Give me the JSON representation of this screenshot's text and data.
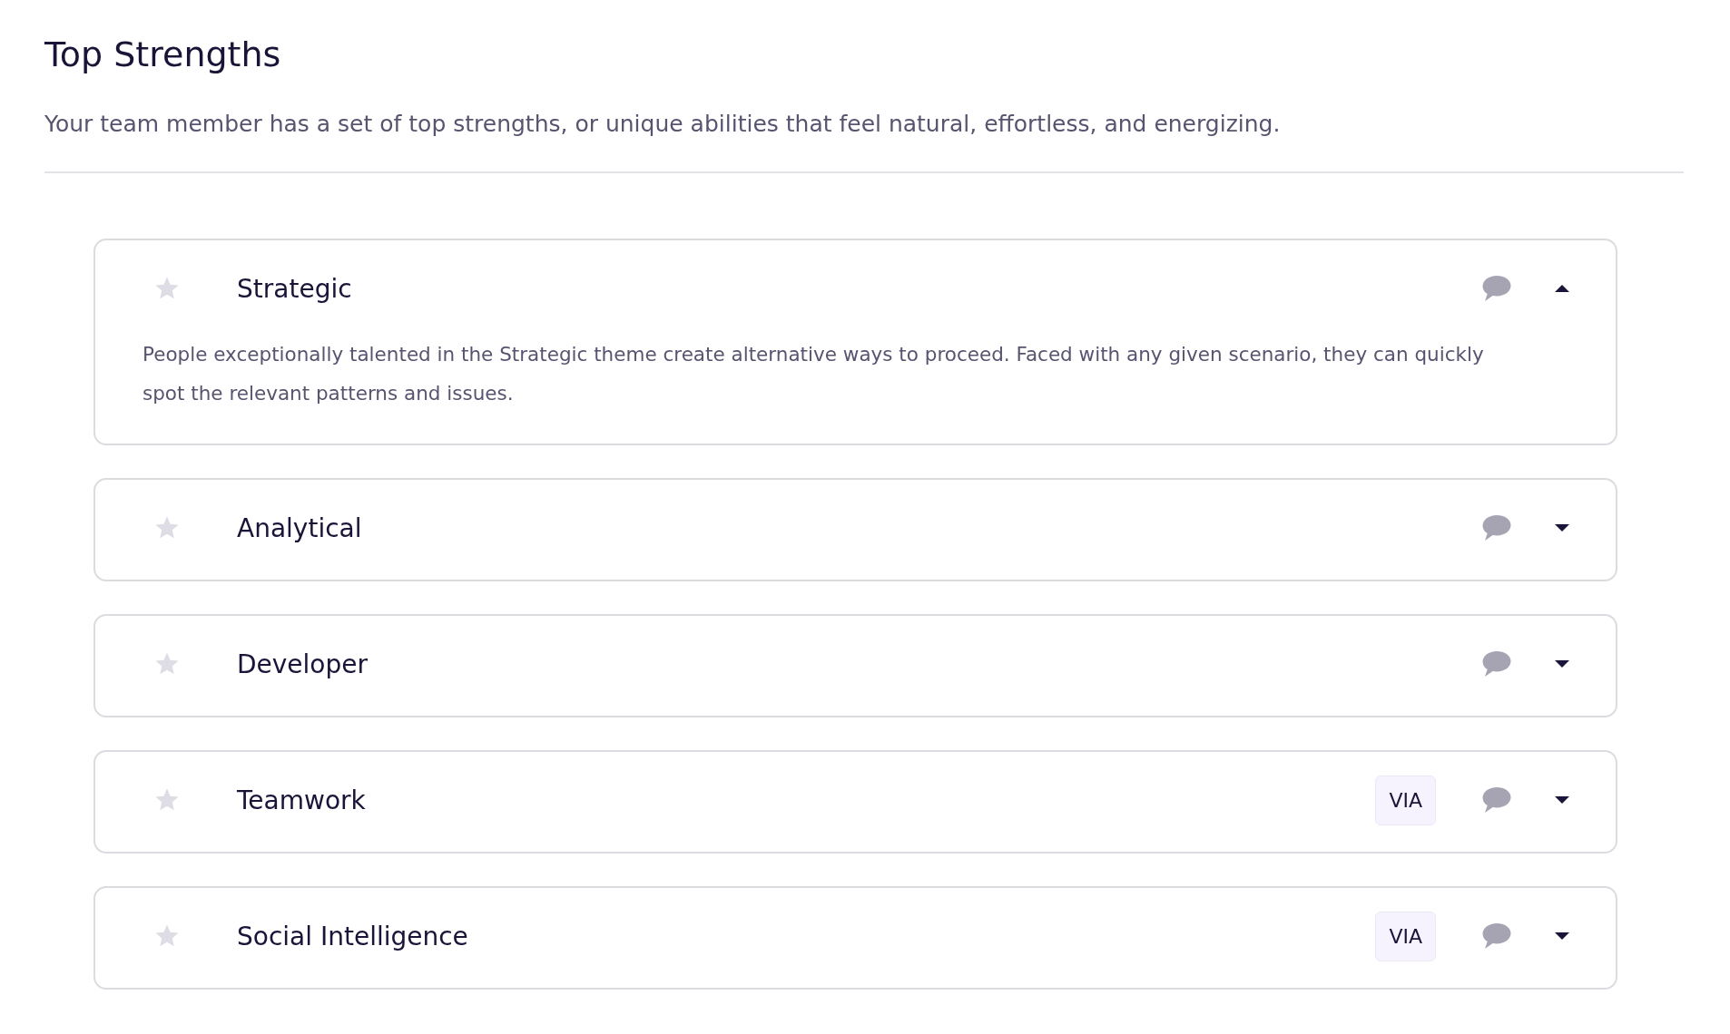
{
  "heading": "Top Strengths",
  "subtitle": "Your team member has a set of top strengths, or unique abilities that feel natural, effortless, and energizing.",
  "strengths": [
    {
      "name": "Strategic",
      "starred": false,
      "expanded": true,
      "description": "People exceptionally talented in the Strategic theme create alternative ways to proceed. Faced with any given scenario, they can quickly spot the relevant patterns and issues."
    },
    {
      "name": "Analytical",
      "starred": false,
      "expanded": false
    },
    {
      "name": "Developer",
      "starred": false,
      "expanded": false
    },
    {
      "name": "Teamwork",
      "starred": false,
      "expanded": false,
      "badge": "VIA"
    },
    {
      "name": "Social Intelligence",
      "starred": false,
      "expanded": false,
      "badge": "VIA"
    }
  ]
}
